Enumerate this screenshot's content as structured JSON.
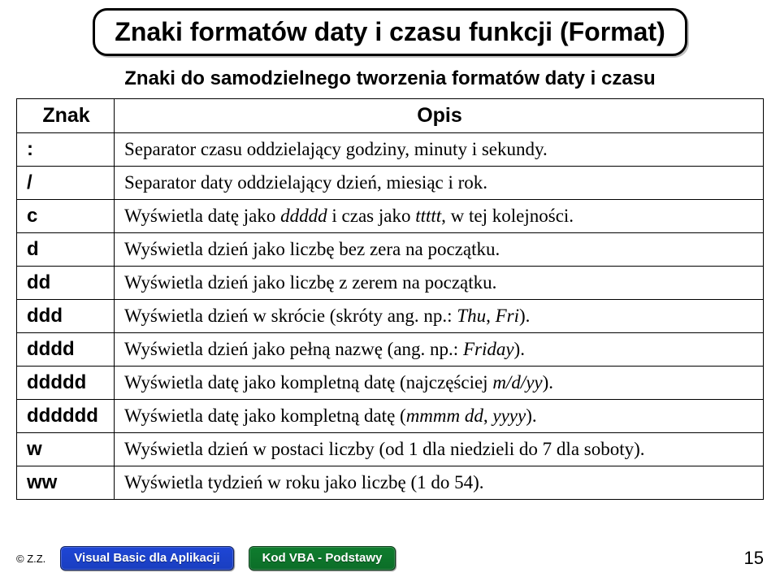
{
  "title": "Znaki formatów daty i czasu funkcji (Format)",
  "subtitle": "Znaki do samodzielnego tworzenia formatów daty i czasu",
  "headers": {
    "col1": "Znak",
    "col2": "Opis"
  },
  "rows": [
    {
      "znak": ":",
      "opis": "Separator czasu oddzielający godziny, minuty i sekundy."
    },
    {
      "znak": "/",
      "opis": "Separator daty oddzielający dzień, miesiąc i rok."
    },
    {
      "znak": "c",
      "opis": "Wyświetla datę jako <em>ddddd</em> i czas jako <em>ttttt</em>, w tej kolejności."
    },
    {
      "znak": "d",
      "opis": "Wyświetla dzień jako liczbę bez zera na początku."
    },
    {
      "znak": "dd",
      "opis": "Wyświetla dzień jako liczbę z zerem na początku."
    },
    {
      "znak": "ddd",
      "opis": "Wyświetla dzień w skrócie (skróty ang. np.: <em>Thu</em>, <em>Fri</em>)."
    },
    {
      "znak": "dddd",
      "opis": "Wyświetla dzień jako pełną nazwę (ang. np.: <em>Friday</em>)."
    },
    {
      "znak": "ddddd",
      "opis": "Wyświetla datę jako kompletną datę (najczęściej <em>m/d/yy</em>)."
    },
    {
      "znak": "dddddd",
      "opis": "Wyświetla datę jako kompletną datę (<em>mmmm dd</em>, <em>yyyy</em>)."
    },
    {
      "znak": "w",
      "opis": "Wyświetla dzień w postaci liczby (od 1 dla niedzieli do 7 dla soboty)."
    },
    {
      "znak": "ww",
      "opis": "Wyświetla tydzień w roku jako liczbę (1 do 54)."
    }
  ],
  "footer": {
    "copyright": "© Z.Z.",
    "pill1": "Visual Basic dla Aplikacji",
    "pill2": "Kod VBA - Podstawy",
    "page": "15"
  }
}
